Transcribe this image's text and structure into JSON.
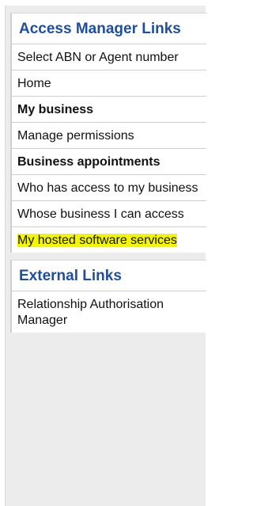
{
  "sidebar": {
    "sections": [
      {
        "title": "Access Manager Links",
        "items": [
          {
            "label": "Select ABN or Agent number",
            "bold": false,
            "highlighted": false
          },
          {
            "label": "Home",
            "bold": false,
            "highlighted": false
          },
          {
            "label": "My business",
            "bold": true,
            "highlighted": false
          },
          {
            "label": "Manage permissions",
            "bold": false,
            "highlighted": false
          },
          {
            "label": "Business appointments",
            "bold": true,
            "highlighted": false
          },
          {
            "label": "Who has access to my business",
            "bold": false,
            "highlighted": false
          },
          {
            "label": "Whose business I can access",
            "bold": false,
            "highlighted": false
          },
          {
            "label": "My hosted software services",
            "bold": false,
            "highlighted": true
          }
        ]
      },
      {
        "title": "External Links",
        "items": [
          {
            "label": "Relationship Authorisation Manager",
            "bold": false,
            "highlighted": false
          }
        ]
      }
    ]
  },
  "colors": {
    "heading": "#1f4f9c",
    "highlight": "#f4f600",
    "panel_background": "#ececec"
  }
}
